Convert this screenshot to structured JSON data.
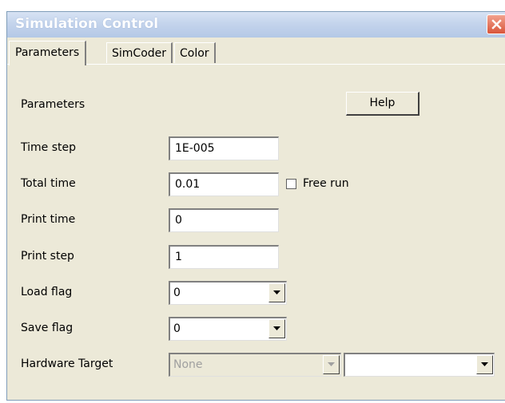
{
  "window": {
    "title": "Simulation Control"
  },
  "tabs": [
    {
      "label": "Parameters",
      "active": true
    },
    {
      "label": "SimCoder",
      "active": false
    },
    {
      "label": "Color",
      "active": false
    }
  ],
  "panel": {
    "heading": "Parameters",
    "help_label": "Help"
  },
  "fields": {
    "time_step": {
      "label": "Time step",
      "value": "1E-005"
    },
    "total_time": {
      "label": "Total time",
      "value": "0.01"
    },
    "free_run": {
      "label": "Free run",
      "checked": false
    },
    "print_time": {
      "label": "Print time",
      "value": "0"
    },
    "print_step": {
      "label": "Print step",
      "value": "1"
    },
    "load_flag": {
      "label": "Load flag",
      "value": "0"
    },
    "save_flag": {
      "label": "Save flag",
      "value": "0"
    },
    "hardware_target": {
      "label": "Hardware Target",
      "value": "None",
      "secondary_value": ""
    }
  },
  "icons": {
    "close": "close-icon",
    "dropdown": "chevron-down-icon"
  },
  "colors": {
    "titlebar": "#c4d4ec",
    "close_button": "#d9553a",
    "dialog_face": "#ece9d8"
  }
}
